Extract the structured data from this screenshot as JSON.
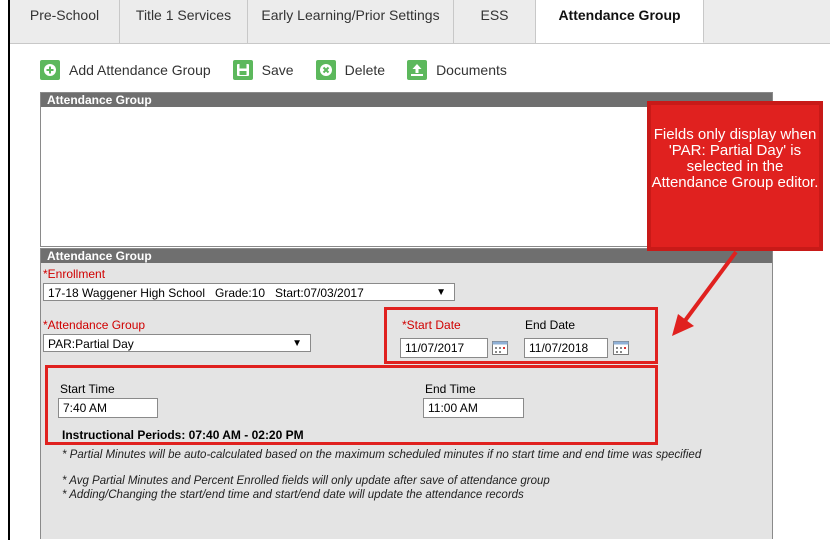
{
  "tabs": [
    "Pre-School",
    "Title 1 Services",
    "Early Learning/Prior Settings",
    "ESS",
    "Attendance Group"
  ],
  "toolbar": {
    "add": "Add Attendance Group",
    "save": "Save",
    "delete": "Delete",
    "documents": "Documents"
  },
  "section_top": {
    "header": "Attendance Group"
  },
  "section_bottom": {
    "header": "Attendance Group",
    "enrollment_label": "Enrollment",
    "enrollment_value": "17-18 Waggener High School   Grade:10   Start:07/03/2017",
    "group_label": "Attendance Group",
    "group_value": "PAR:Partial Day",
    "start_date_label": "Start Date",
    "start_date_value": "11/07/2017",
    "end_date_label": "End Date",
    "end_date_value": "11/07/2018",
    "start_time_label": "Start Time",
    "start_time_value": "7:40 AM",
    "end_time_label": "End Time",
    "end_time_value": "11:00 AM",
    "instructional_periods": "Instructional Periods: 07:40 AM - 02:20 PM",
    "required_marker": "*"
  },
  "notes": [
    "* Partial Minutes will be auto-calculated based on the maximum scheduled minutes if no start time and end time was specified",
    "* Avg Partial Minutes and Percent Enrolled fields will only update after save of attendance group",
    "* Adding/Changing the start/end time and start/end date will update the attendance records"
  ],
  "callout": "Fields only display when 'PAR: Partial Day' is selected in the Attendance Group editor.",
  "colors": {
    "accent_green": "#5cb85c",
    "required_red": "#d00000",
    "annotation_red": "#e0211f",
    "header_grey": "#6f6f6f"
  }
}
